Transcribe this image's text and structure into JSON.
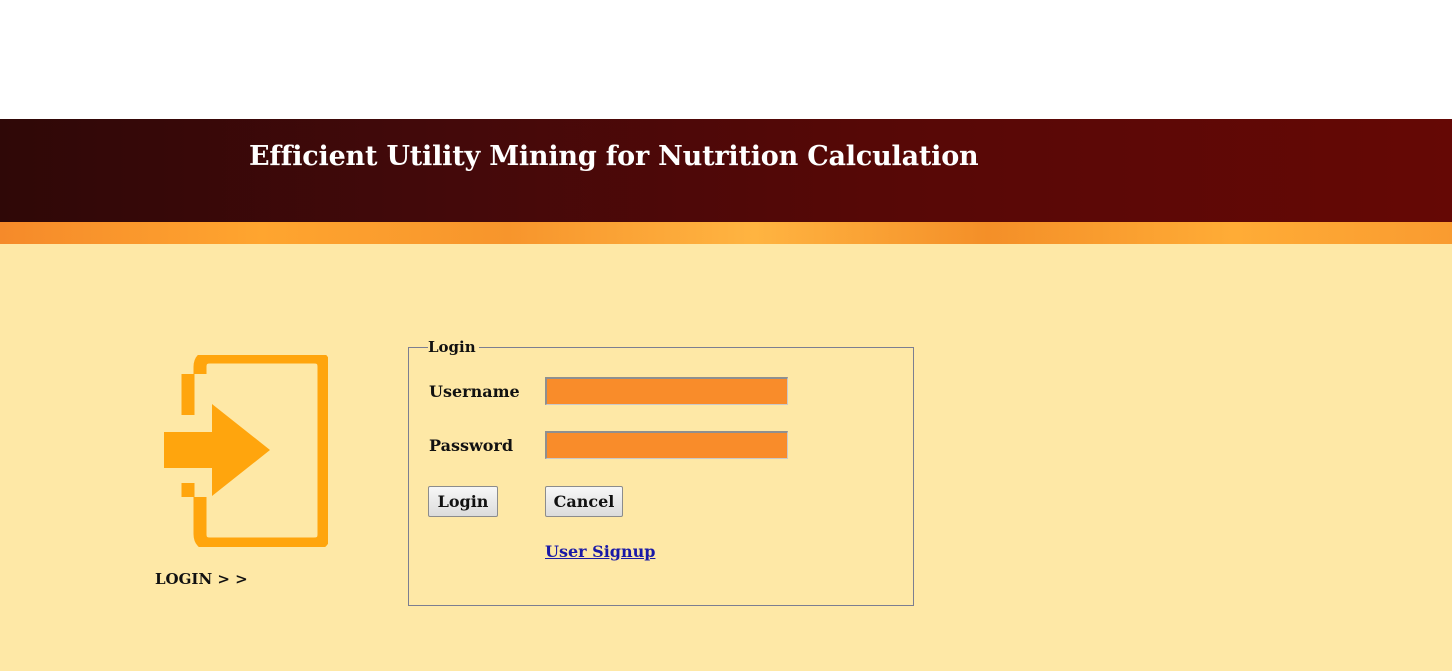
{
  "header": {
    "title": "Efficient Utility Mining for Nutrition Calculation"
  },
  "sidebar": {
    "icon": "login-enter-icon",
    "caption": "LOGIN > >"
  },
  "login_form": {
    "legend": "Login",
    "username_label": "Username",
    "username_value": "",
    "password_label": "Password",
    "password_value": "",
    "login_button": "Login",
    "cancel_button": "Cancel",
    "signup_link": "User Signup"
  },
  "colors": {
    "header_bg": "#4a0908",
    "stripe": "#f99b30",
    "content_bg": "#fee8a6",
    "input_bg": "#f98c2a",
    "icon": "#ffa50d",
    "link": "#1a1aa6"
  }
}
